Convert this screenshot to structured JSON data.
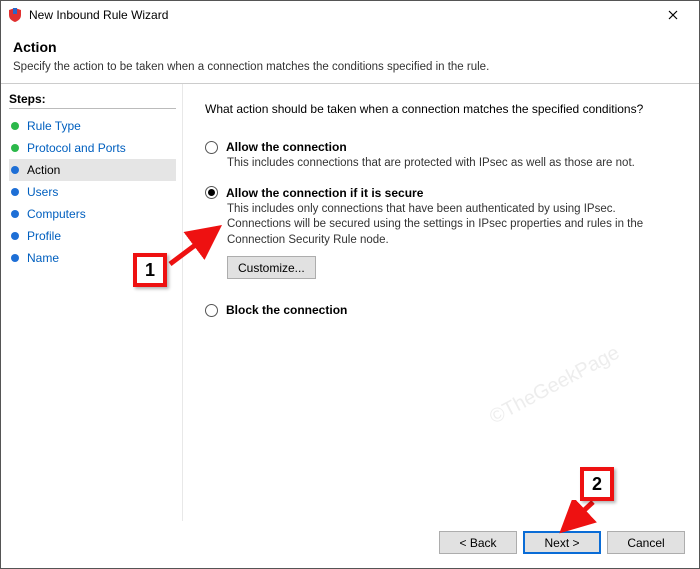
{
  "titlebar": {
    "title": "New Inbound Rule Wizard"
  },
  "header": {
    "title": "Action",
    "subtitle": "Specify the action to be taken when a connection matches the conditions specified in the rule."
  },
  "sidebar": {
    "heading": "Steps:",
    "steps": [
      {
        "label": "Rule Type",
        "done": true
      },
      {
        "label": "Protocol and Ports",
        "done": true
      },
      {
        "label": "Action",
        "done": false,
        "active": true
      },
      {
        "label": "Users",
        "done": false
      },
      {
        "label": "Computers",
        "done": false
      },
      {
        "label": "Profile",
        "done": false
      },
      {
        "label": "Name",
        "done": false
      }
    ]
  },
  "main": {
    "prompt": "What action should be taken when a connection matches the specified conditions?",
    "options": [
      {
        "label": "Allow the connection",
        "desc": "This includes connections that are protected with IPsec as well as those are not.",
        "selected": false
      },
      {
        "label": "Allow the connection if it is secure",
        "desc": "This includes only connections that have been authenticated by using IPsec.  Connections will be secured using the settings in IPsec properties and rules in the Connection Security Rule node.",
        "selected": true,
        "customize": "Customize..."
      },
      {
        "label": "Block the connection",
        "selected": false
      }
    ]
  },
  "footer": {
    "back": "< Back",
    "next": "Next >",
    "cancel": "Cancel"
  },
  "callouts": {
    "one": "1",
    "two": "2"
  },
  "watermark": "©TheGeekPage"
}
